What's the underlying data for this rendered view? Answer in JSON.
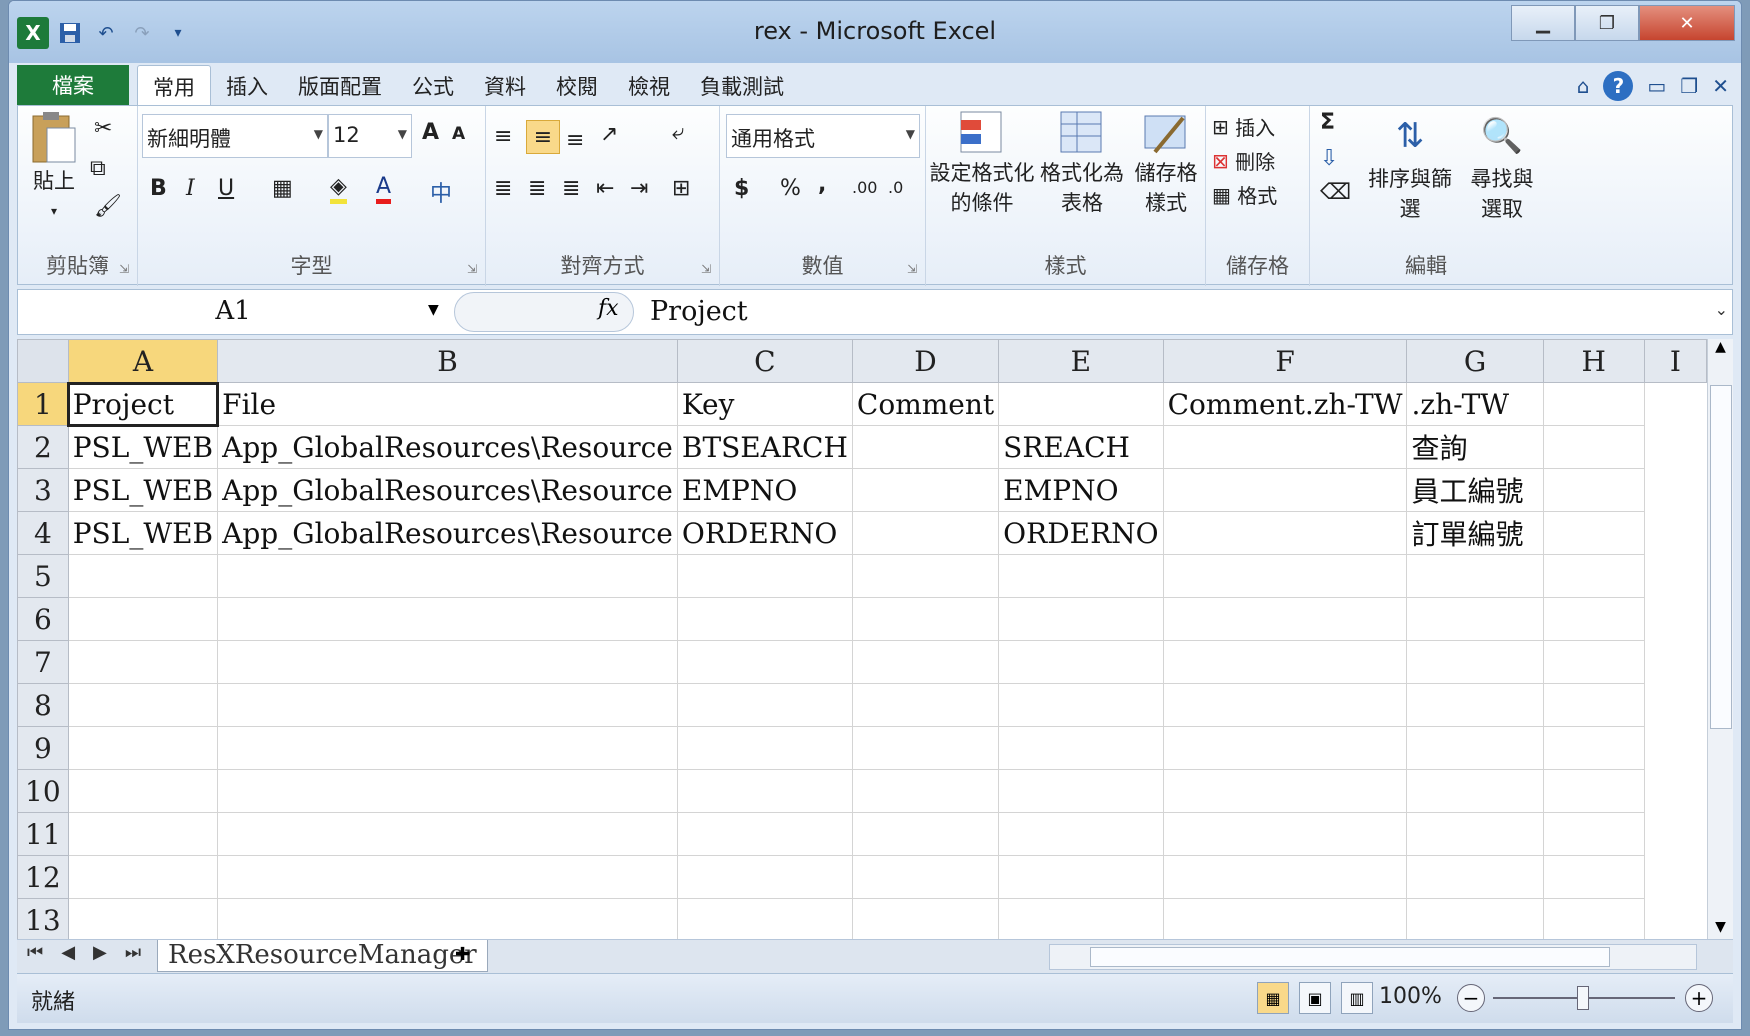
{
  "window": {
    "title": "rex - Microsoft Excel"
  },
  "qat": {
    "logo": "X"
  },
  "tabs": {
    "file": "檔案",
    "items": [
      "常用",
      "插入",
      "版面配置",
      "公式",
      "資料",
      "校閱",
      "檢視",
      "負載測試"
    ]
  },
  "ribbon": {
    "clipboard": {
      "label": "剪貼簿",
      "paste": "貼上"
    },
    "font": {
      "label": "字型",
      "name": "新細明體",
      "size": "12",
      "bold": "B",
      "italic": "I",
      "underline": "U",
      "grow": "A",
      "shrink": "A",
      "color_a": "A",
      "phonetic": "中"
    },
    "align": {
      "label": "對齊方式"
    },
    "number": {
      "label": "數值",
      "format": "通用格式",
      "currency": "$",
      "percent": "%",
      "comma": ","
    },
    "styles": {
      "label": "樣式",
      "cond": "設定格式化的條件",
      "cond_l1": "設定格式化",
      "cond_l2": "的條件",
      "table_l1": "格式化為",
      "table_l2": "表格",
      "cell_l1": "儲存格",
      "cell_l2": "樣式"
    },
    "cells": {
      "label": "儲存格",
      "insert": "插入",
      "delete": "刪除",
      "format": "格式"
    },
    "editing": {
      "label": "編輯",
      "sum": "Σ",
      "sort": "排序與篩選",
      "find_l1": "尋找與",
      "find_l2": "選取"
    }
  },
  "formula": {
    "namebox": "A1",
    "fx": "fx",
    "value": "Project"
  },
  "grid": {
    "columns": [
      "A",
      "B",
      "C",
      "D",
      "E",
      "F",
      "G",
      "H",
      "I"
    ],
    "rows": [
      [
        "1",
        "Project",
        "File",
        "Key",
        "Comment",
        "",
        "Comment.zh-TW",
        ".zh-TW",
        ""
      ],
      [
        "2",
        "PSL_WEB",
        "App_GlobalResources\\Resource",
        "BTSEARCH",
        "",
        "SREACH",
        "",
        "查詢",
        ""
      ],
      [
        "3",
        "PSL_WEB",
        "App_GlobalResources\\Resource",
        "EMPNO",
        "",
        "EMPNO",
        "",
        "員工編號",
        ""
      ],
      [
        "4",
        "PSL_WEB",
        "App_GlobalResources\\Resource",
        "ORDERNO",
        "",
        "ORDERNO",
        "",
        "訂單編號",
        ""
      ],
      [
        "5",
        "",
        "",
        "",
        "",
        "",
        "",
        "",
        ""
      ],
      [
        "6",
        "",
        "",
        "",
        "",
        "",
        "",
        "",
        ""
      ],
      [
        "7",
        "",
        "",
        "",
        "",
        "",
        "",
        "",
        ""
      ],
      [
        "8",
        "",
        "",
        "",
        "",
        "",
        "",
        "",
        ""
      ],
      [
        "9",
        "",
        "",
        "",
        "",
        "",
        "",
        "",
        ""
      ],
      [
        "10",
        "",
        "",
        "",
        "",
        "",
        "",
        "",
        ""
      ],
      [
        "11",
        "",
        "",
        "",
        "",
        "",
        "",
        "",
        ""
      ],
      [
        "12",
        "",
        "",
        "",
        "",
        "",
        "",
        "",
        ""
      ],
      [
        "13",
        "",
        "",
        "",
        "",
        "",
        "",
        "",
        ""
      ]
    ]
  },
  "sheets": {
    "active": "ResXResourceManager"
  },
  "status": {
    "ready": "就緒",
    "zoom": "100%"
  },
  "colors": {
    "file_tab": "#1e7b3a",
    "selected_header": "#f7d77c"
  }
}
